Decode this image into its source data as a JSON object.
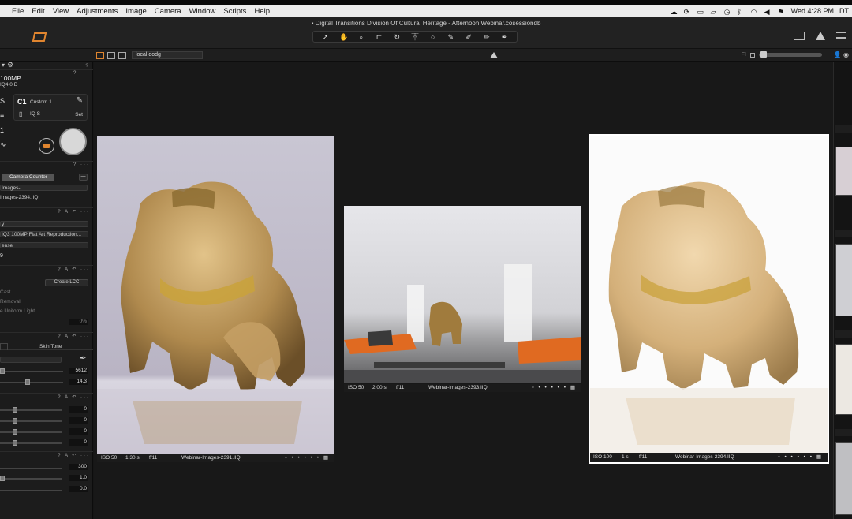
{
  "menu": {
    "items": [
      "File",
      "Edit",
      "View",
      "Adjustments",
      "Image",
      "Camera",
      "Window",
      "Scripts",
      "Help"
    ],
    "clock": "Wed 4:28 PM",
    "user": "DT"
  },
  "window": {
    "title": "Digital Transitions Division Of Cultural Heritage - Afternoon Webinar.cosessiondb"
  },
  "toolbar": {
    "tools": [
      "pointer-tool",
      "pan-tool",
      "crop-tool",
      "straighten-tool",
      "keystone-tool",
      "rotate-tool",
      "spot-tool",
      "brush-tool",
      "eraser-tool",
      "gradient-tool",
      "picker-tool"
    ]
  },
  "subbar": {
    "album": "local dodg",
    "fi_label": "FI"
  },
  "left_panel": {
    "camera_model": "100MP",
    "camera_sub": "IQ4.0 D",
    "style_code": "C1",
    "style_name": "Custom 1",
    "style_file": "IQ S",
    "set_label": "Set",
    "camera_counter": "Camera Counter",
    "next_name_prefix": "Images-",
    "next_name": "Images-2394.IIQ",
    "dropdown_1": "y",
    "profile": "IQ3 100MP Flat Art Reproduction...",
    "lens": "ense",
    "lens_value": "9",
    "create_lcc": "Create LCC",
    "lcc_option_1": "Cast",
    "lcc_option_2": "Removal",
    "lcc_option_3": "e Uniform Light",
    "lcc_value": "0%",
    "skin_tone_tab": "Skin Tone",
    "wb_kelvin": "5612",
    "wb_tint": "14.3",
    "exp_values": [
      "0",
      "0",
      "0",
      "0"
    ],
    "hdr_values": [
      "300",
      "1.0",
      "0.0"
    ]
  },
  "viewers": [
    {
      "iso": "ISO 50",
      "shutter": "1.30 s",
      "aperture": "f/11",
      "filename": "Webinar-Images-2391.IIQ"
    },
    {
      "iso": "ISO 50",
      "shutter": "2.00 s",
      "aperture": "f/11",
      "filename": "Webinar-Images-2393.IIQ"
    },
    {
      "iso": "ISO 100",
      "shutter": "1 s",
      "aperture": "f/11",
      "filename": "Webinar-Images-2394.IIQ"
    }
  ],
  "colors": {
    "accent": "#e0852f",
    "panel_bg": "#1c1c1c",
    "canvas_bg": "#181818",
    "selection_border": "#ffffff"
  }
}
